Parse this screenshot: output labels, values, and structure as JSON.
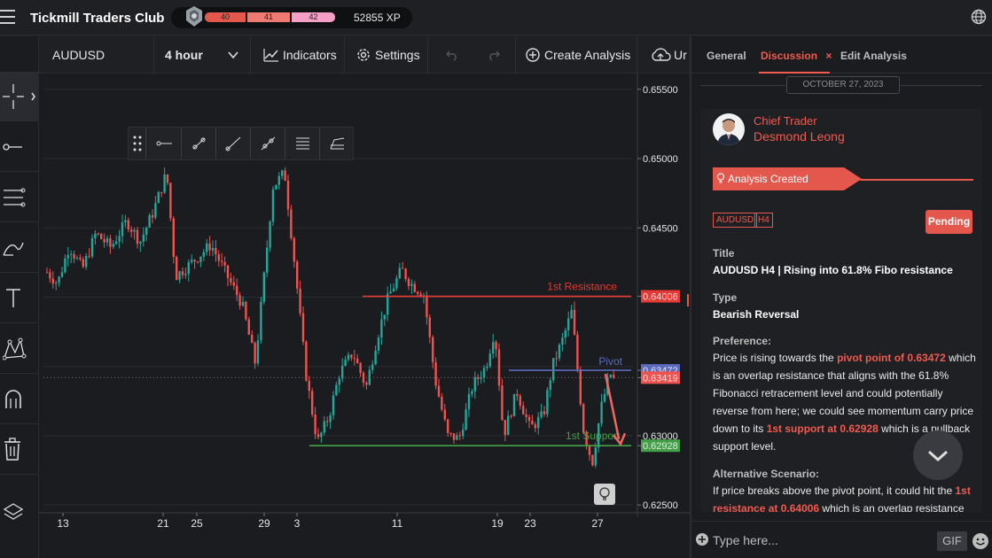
{
  "app": {
    "title": "Tickmill Traders Club"
  },
  "xp": {
    "levels": [
      "40",
      "41",
      "42"
    ],
    "xp_text": "52855 XP"
  },
  "toolbar": {
    "symbol": "AUDUSD",
    "timeframe": "4 hour",
    "indicators_label": "Indicators",
    "settings_label": "Settings",
    "create_label": "Create Analysis",
    "upload_label": "Ur"
  },
  "chart": {
    "price_labels": [
      "0.65500",
      "0.65000",
      "0.64500",
      "0.64006",
      "0.63472",
      "0.63419",
      "0.63000",
      "0.62928",
      "0.62500"
    ],
    "date_labels": [
      "13",
      "21",
      "25",
      "29",
      "3",
      "11",
      "19",
      "23",
      "27"
    ],
    "annotations": {
      "resistance": "1st Resistance",
      "pivot": "Pivot",
      "support": "1st Support"
    },
    "levels": {
      "resistance": 0.64006,
      "pivot": 0.63472,
      "current": 0.63419,
      "support": 0.62928
    },
    "colors": {
      "up": "#26a69a",
      "down": "#ef5350",
      "resistance": "#e53935",
      "pivot": "#5c6bc0",
      "support": "#43a047"
    }
  },
  "panel": {
    "tabs": [
      "General",
      "Discussion",
      "Edit Analysis"
    ],
    "date": "OCTOBER 27, 2023",
    "author_role": "Chief Trader",
    "author_name": "Desmond Leong",
    "created": "Analysis Created",
    "tags": [
      "AUDUSD",
      "H4"
    ],
    "status": "Pending",
    "title_label": "Title",
    "title_value": "AUDUSD H4 | Rising into 61.8% Fibo resistance",
    "type_label": "Type",
    "type_value": "Bearish Reversal",
    "pref_label": "Preference:",
    "pref_1": "Price is rising towards the ",
    "pref_hl1": "pivot point of 0.63472",
    "pref_2": " which is an overlap resistance that aligns with the 61.8% Fibonacci retracement level and could potentially reverse from here; we could see momentum carry price down to its ",
    "pref_hl2": "1st support at 0.62928",
    "pref_3": " which is a pullback support level.",
    "alt_label": "Alternative Scenario:",
    "alt_1": "If price breaks above the pivot point, it could hit the ",
    "alt_hl1": "1st resistance at 0.64006",
    "alt_2": " which is an overlap resistance",
    "input_placeholder": "Type here...",
    "gif_label": "GIF"
  }
}
